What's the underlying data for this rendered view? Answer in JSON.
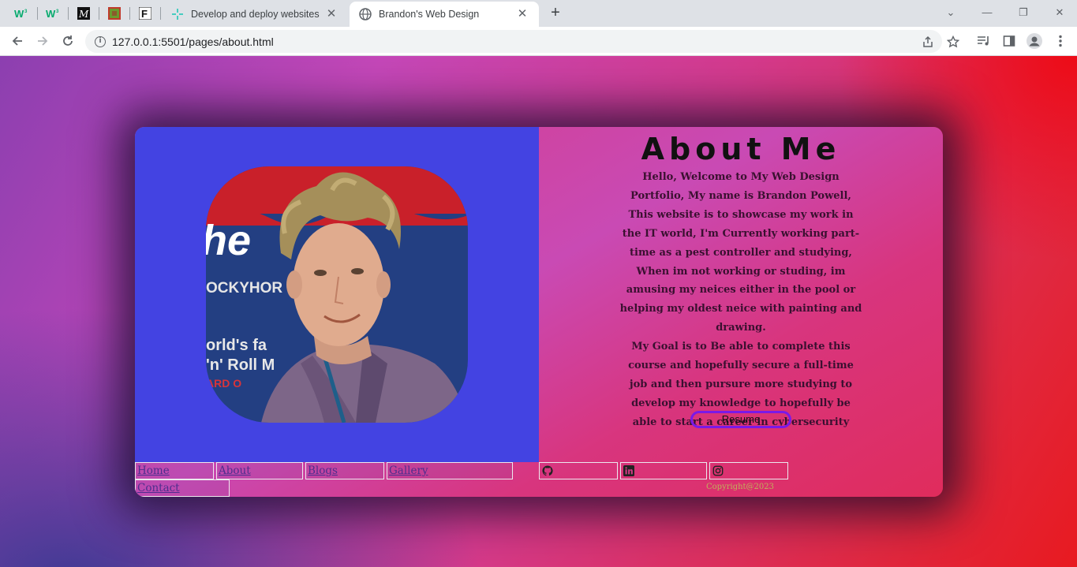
{
  "browser": {
    "tabs": [
      {
        "title": "Develop and deploy websites and",
        "icon": "netlify-icon"
      },
      {
        "title": "Brandon's Web Design",
        "icon": "globe-icon",
        "active": true
      }
    ],
    "pinned_tabs": [
      "w3schools-icon",
      "w3schools-icon",
      "medium-icon",
      "minecraft-icon",
      "figma-icon"
    ],
    "url": "127.0.0.1:5501/pages/about.html"
  },
  "page": {
    "heading": "About Me",
    "intro": "Hello, Welcome to My Web Design Portfolio, My name is Brandon Powell, This website is to showcase my work in the IT world, I'm Currently working part-time as a pest controller and studying, When im not working or studing, im amusing my neices either in the pool or helping my oldest neice with painting and drawing.",
    "goal": "My Goal is to Be able to complete this course and hopefully secure a full-time job and then pursure more studying to develop my knowledge to hopefully be able to start a career in cybersecurity",
    "resume_label": "Resume",
    "nav": {
      "home": "Home",
      "about": "About",
      "blogs": "Blogs",
      "gallery": "Gallery",
      "contact": "Contact"
    },
    "social_icons": [
      "github-icon",
      "linkedin-icon",
      "instagram-icon"
    ],
    "copyright": "Copyright@2023"
  },
  "colors": {
    "left_panel": "#4343e2",
    "resume_border": "#7a19e8"
  }
}
